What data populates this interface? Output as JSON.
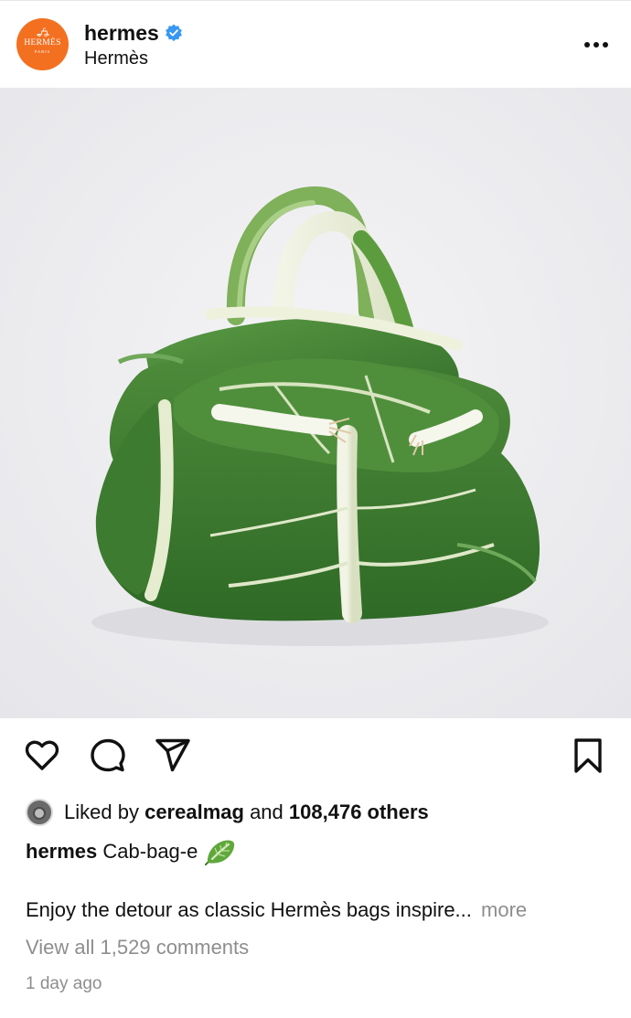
{
  "post": {
    "account": {
      "username": "hermes",
      "display_name": "Hermès",
      "verified": true,
      "avatar_wordmark": "HERMÈS",
      "avatar_sub": "PARIS",
      "avatar_color": "#f37021",
      "verified_color": "#3897f0"
    },
    "image": {
      "background_color": "#eeeef1"
    },
    "actions": {
      "like_icon": "heart-icon",
      "comment_icon": "comment-icon",
      "share_icon": "send-icon",
      "save_icon": "bookmark-icon"
    },
    "likes": {
      "prefix": "Liked by",
      "user": "cerealmag",
      "middle": "and",
      "others": "108,476 others"
    },
    "caption": {
      "username": "hermes",
      "text": "Cab-bag-e",
      "emoji_icon": "leafy-green-icon"
    },
    "description": {
      "text": "Enjoy the detour as classic Hermès bags inspire...",
      "more_label": "more"
    },
    "view_comments": "View all 1,529 comments",
    "timestamp": "1 day ago"
  }
}
